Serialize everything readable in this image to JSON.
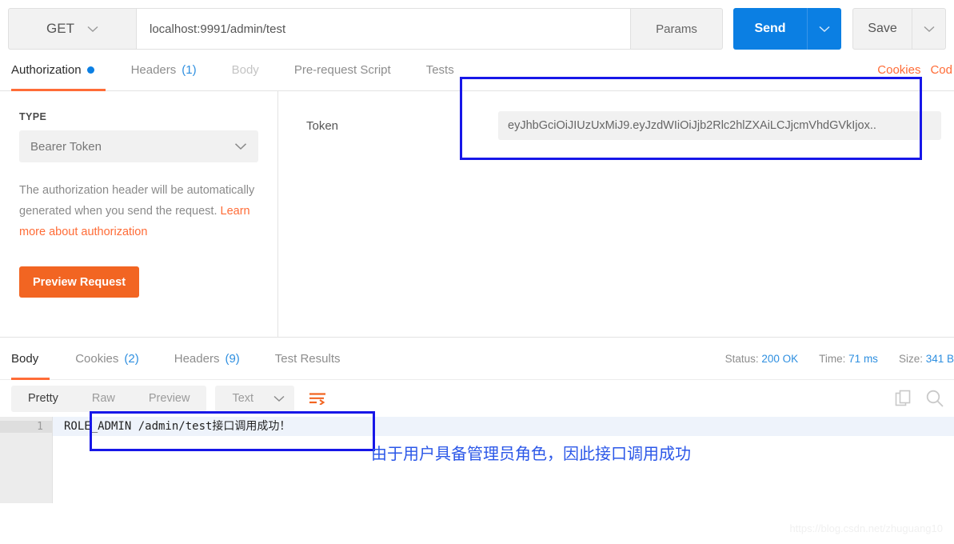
{
  "urlbar": {
    "method": "GET",
    "url": "localhost:9991/admin/test",
    "params_label": "Params",
    "send_label": "Send",
    "save_label": "Save",
    "caret": "⌄"
  },
  "request_tabs": [
    {
      "label": "Authorization",
      "badge": "",
      "state": "active",
      "dot": true
    },
    {
      "label": "Headers",
      "badge": "(1)",
      "state": "normal",
      "dot": false
    },
    {
      "label": "Body",
      "badge": "",
      "state": "disabled",
      "dot": false
    },
    {
      "label": "Pre-request Script",
      "badge": "",
      "state": "normal",
      "dot": false
    },
    {
      "label": "Tests",
      "badge": "",
      "state": "normal",
      "dot": false
    }
  ],
  "request_tabs_right": {
    "cookies": "Cookies",
    "code": "Cod"
  },
  "auth": {
    "type_heading": "TYPE",
    "type_value": "Bearer Token",
    "description_plain": "The authorization header will be automatically generated when you send the request. ",
    "description_link": "Learn more about authorization",
    "preview_button": "Preview Request",
    "token_label": "Token",
    "token_value": "eyJhbGciOiJIUzUxMiJ9.eyJzdWIiOiJjb2Rlc2hlZXAiLCJjcmVhdGVkIjox.."
  },
  "response_tabs": [
    {
      "label": "Body",
      "badge": "",
      "state": "active"
    },
    {
      "label": "Cookies",
      "badge": "(2)",
      "state": "normal"
    },
    {
      "label": "Headers",
      "badge": "(9)",
      "state": "normal"
    },
    {
      "label": "Test Results",
      "badge": "",
      "state": "normal"
    }
  ],
  "response_meta": {
    "status_label": "Status:",
    "status_value": "200 OK",
    "time_label": "Time:",
    "time_value": "71 ms",
    "size_label": "Size:",
    "size_value": "341 B"
  },
  "response_toolbar": {
    "pretty": "Pretty",
    "raw": "Raw",
    "preview": "Preview",
    "format": "Text",
    "caret": "⌄",
    "wrap_icon": "word-wrap-icon",
    "copy_icon": "copy-icon",
    "search_icon": "search-icon"
  },
  "response_body": {
    "line_number": "1",
    "content": "ROLE_ADMIN /admin/test接口调用成功！"
  },
  "annotations": {
    "note_text": "由于用户具备管理员角色，因此接口调用成功",
    "box_color": "#1717e8",
    "note_color": "#2b57e8"
  },
  "watermark": "https://blog.csdn.net/zhuguang10",
  "colors": {
    "accent_orange": "#ff6c37",
    "send_blue": "#0b7fe3",
    "link_blue": "#2e8fe0",
    "preview_orange": "#f26522"
  }
}
